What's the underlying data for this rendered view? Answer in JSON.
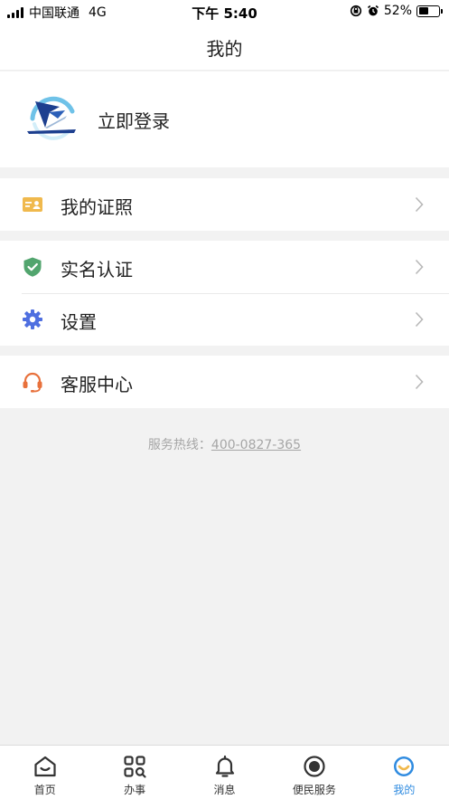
{
  "status_bar": {
    "carrier": "中国联通",
    "network": "4G",
    "time": "下午 5:40",
    "battery_percent": "52%",
    "battery_level": 0.52
  },
  "header": {
    "title": "我的"
  },
  "profile": {
    "login_label": "立即登录"
  },
  "menu": {
    "certificates": {
      "label": "我的证照",
      "icon": "id-card-icon"
    },
    "realname": {
      "label": "实名认证",
      "icon": "shield-check-icon"
    },
    "settings": {
      "label": "设置",
      "icon": "gear-icon"
    },
    "service": {
      "label": "客服中心",
      "icon": "headset-icon"
    }
  },
  "hotline": {
    "label": "服务热线：",
    "number": "400-0827-365"
  },
  "tabbar": {
    "items": [
      {
        "label": "首页",
        "icon": "home-icon"
      },
      {
        "label": "办事",
        "icon": "grid-search-icon"
      },
      {
        "label": "消息",
        "icon": "bell-icon"
      },
      {
        "label": "便民服务",
        "icon": "record-icon"
      },
      {
        "label": "我的",
        "icon": "smile-face-icon",
        "active": true
      }
    ]
  },
  "colors": {
    "accent": "#2f8be0",
    "card_icon": "#f0b94d",
    "shield": "#52a56e",
    "gear": "#4f6fe0",
    "headset": "#e8713c"
  }
}
